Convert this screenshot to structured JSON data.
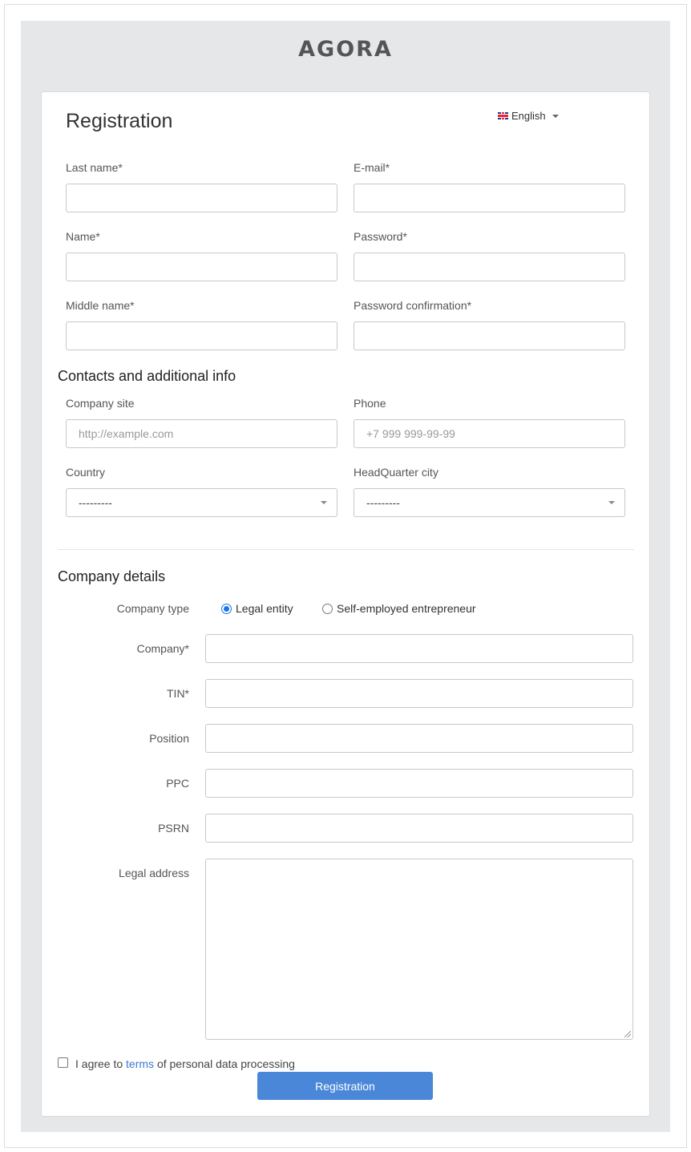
{
  "brand": {
    "logo_text": "AGORA"
  },
  "form": {
    "title": "Registration",
    "language": {
      "label": "English",
      "flag": "uk-flag-icon"
    },
    "personal": {
      "last_name_label": "Last name*",
      "email_label": "E-mail*",
      "name_label": "Name*",
      "password_label": "Password*",
      "middle_name_label": "Middle name*",
      "password_confirm_label": "Password confirmation*"
    },
    "contacts": {
      "heading": "Contacts and additional info",
      "company_site_label": "Company site",
      "company_site_placeholder": "http://example.com",
      "phone_label": "Phone",
      "phone_placeholder": "+7 999 999-99-99",
      "country_label": "Country",
      "country_value": "---------",
      "city_label": "HeadQuarter city",
      "city_value": "---------"
    },
    "company": {
      "heading": "Company details",
      "type_label": "Company type",
      "type_options": [
        "Legal entity",
        "Self-employed entrepreneur"
      ],
      "type_selected": "Legal entity",
      "company_label": "Company*",
      "tin_label": "TIN*",
      "position_label": "Position",
      "ppc_label": "PPC",
      "psrn_label": "PSRN",
      "legal_address_label": "Legal address"
    },
    "agreement": {
      "prefix": "I agree to",
      "link_text": "terms",
      "suffix": "of personal data processing",
      "checked": false
    },
    "submit_label": "Registration"
  },
  "colors": {
    "page_bg": "#e6e7e8",
    "accent": "#4a87d8",
    "link": "#3c7bd6"
  }
}
